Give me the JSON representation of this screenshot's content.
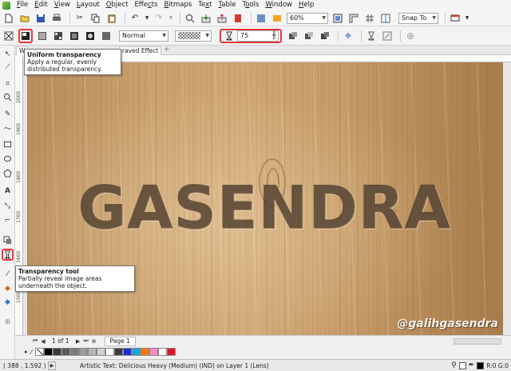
{
  "menu": [
    "File",
    "Edit",
    "View",
    "Layout",
    "Object",
    "Effects",
    "Bitmaps",
    "Text",
    "Table",
    "Tools",
    "Window",
    "Help"
  ],
  "menu_underline": [
    "F",
    "E",
    "V",
    "L",
    "O",
    "C",
    "B",
    "X",
    "T",
    "O",
    "W",
    "H"
  ],
  "toolbar1": {
    "zoom": "60%",
    "snap_to": "Snap To"
  },
  "toolbar2": {
    "merge_mode": "Normal",
    "transparency_value": "75"
  },
  "tooltips": {
    "uniform": {
      "title": "Uniform transparency",
      "body": "Apply a regular, evenly distributed transparency."
    },
    "tool": {
      "title": "Transparency tool",
      "body": "Partially reveal image areas underneath the object."
    }
  },
  "document_tab": {
    "left_label": "W",
    "label": "raved Effect"
  },
  "ruler_left_numbers": [
    "2000",
    "1900",
    "1800",
    "1700",
    "1600",
    "1500"
  ],
  "canvas": {
    "headline": "GASENDRA",
    "watermark": "@galihgasendra"
  },
  "page_nav": {
    "page_count": "1 of 1",
    "page_tab": "Page 1"
  },
  "palette": [
    "#000000",
    "#3a3a3a",
    "#5a5a5a",
    "#7a7a7a",
    "#9a9a9a",
    "#b5b5b5",
    "#d0d0d0",
    "#ffffff",
    "#3c3c3c",
    "#1f2bd8",
    "#0aa6df",
    "#ff7b00",
    "#ff89c8",
    "#ffffff",
    "#e81123"
  ],
  "status": {
    "coords": "( 388 , 1.592 )",
    "object_info": "Artistic Text: Delicious Heavy (Medium) (IND) on Layer 1  (Lens)",
    "fill_value": "R:0 G:0"
  },
  "colors": {
    "highlight": "#e8373b"
  }
}
